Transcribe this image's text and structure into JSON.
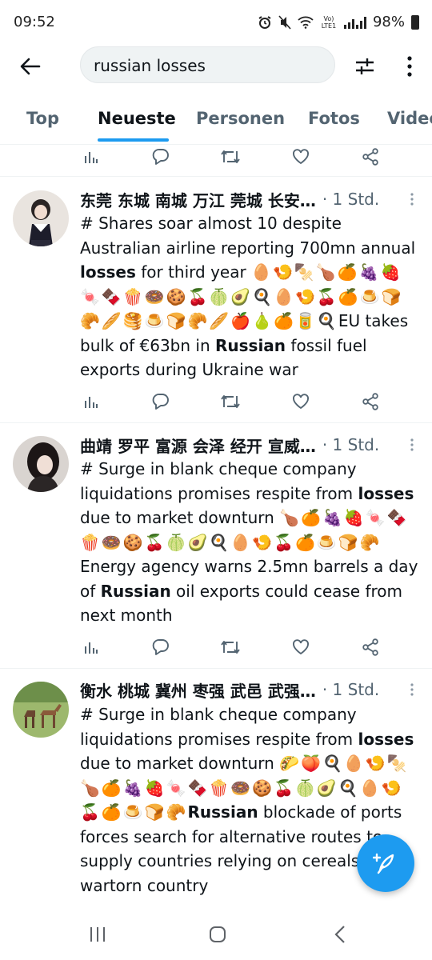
{
  "status_bar": {
    "time": "09:52",
    "network": "Vo) LTE1",
    "battery": "98%"
  },
  "search": {
    "query": "russian losses"
  },
  "tabs": [
    {
      "label": "Top"
    },
    {
      "label": "Neueste"
    },
    {
      "label": "Personen"
    },
    {
      "label": "Fotos"
    },
    {
      "label": "Video"
    }
  ],
  "active_tab": "Neueste",
  "tweets": [
    {
      "author": "东莞 东城 南城 万江 莞城 长安…",
      "time": "· 1 Std.",
      "text_1": "# Shares soar almost 10 despite Australian airline reporting 700mn annual ",
      "bold_1": "losses",
      "text_2": " for third year ",
      "emoji_1": "🥚🍤🍢🍗🍊🍇🍓🍬🍫🍿🍩🍪🍒🍈🥑🍳🥚🍤🍒🍊🍮🍞🥐🥖🥞🍮🍞🥐🥖🍎🍐🍊🥫🍳",
      "text_3": "EU takes bulk of €63bn in ",
      "bold_2": "Russian",
      "text_4": " fossil fuel exports during Ukraine war"
    },
    {
      "author": "曲靖 罗平 富源 会泽 经开 宣威…",
      "time": "· 1 Std.",
      "text_1": "# Surge in blank cheque company liquidations promises respite from ",
      "bold_1": "losses",
      "text_2": " due to market downturn ",
      "emoji_1": "🍗🍊🍇🍓🍬🍫🍿🍩🍪🍒🍈🥑🍳🥚🍤🍒🍊🍮🍞🥐",
      "text_3": "Energy agency warns 2.5mn barrels a day of ",
      "bold_2": "Russian",
      "text_4": " oil exports could cease from next month"
    },
    {
      "author": "衡水 桃城 冀州 枣强 武邑 武强…",
      "time": "· 1 Std.",
      "text_1": "# Surge in blank cheque company liquidations promises respite from ",
      "bold_1": "losses",
      "text_2": " due to market downturn ",
      "emoji_1": "🌮🍑🍳🥚🍤🍢🍗🍊🍇🍓🍬🍫🍿🍩🍪🍒🍈🥑🍳🥚🍤🍒🍊🍮🍞🥐",
      "text_3": "",
      "bold_2": "Russian",
      "text_4": " blockade of ports forces search for alternative routes to supply countries relying on cereals from wartorn country"
    }
  ],
  "colors": {
    "accent": "#1d9bf0",
    "text": "#0f1419",
    "muted": "#536471"
  },
  "icons": {
    "back": "arrow-left-icon",
    "filter": "sliders-icon",
    "more": "more-vertical-icon",
    "views": "bar-chart-icon",
    "reply": "comment-icon",
    "retweet": "retweet-icon",
    "like": "heart-icon",
    "share": "share-icon",
    "compose": "feather-plus-icon"
  }
}
